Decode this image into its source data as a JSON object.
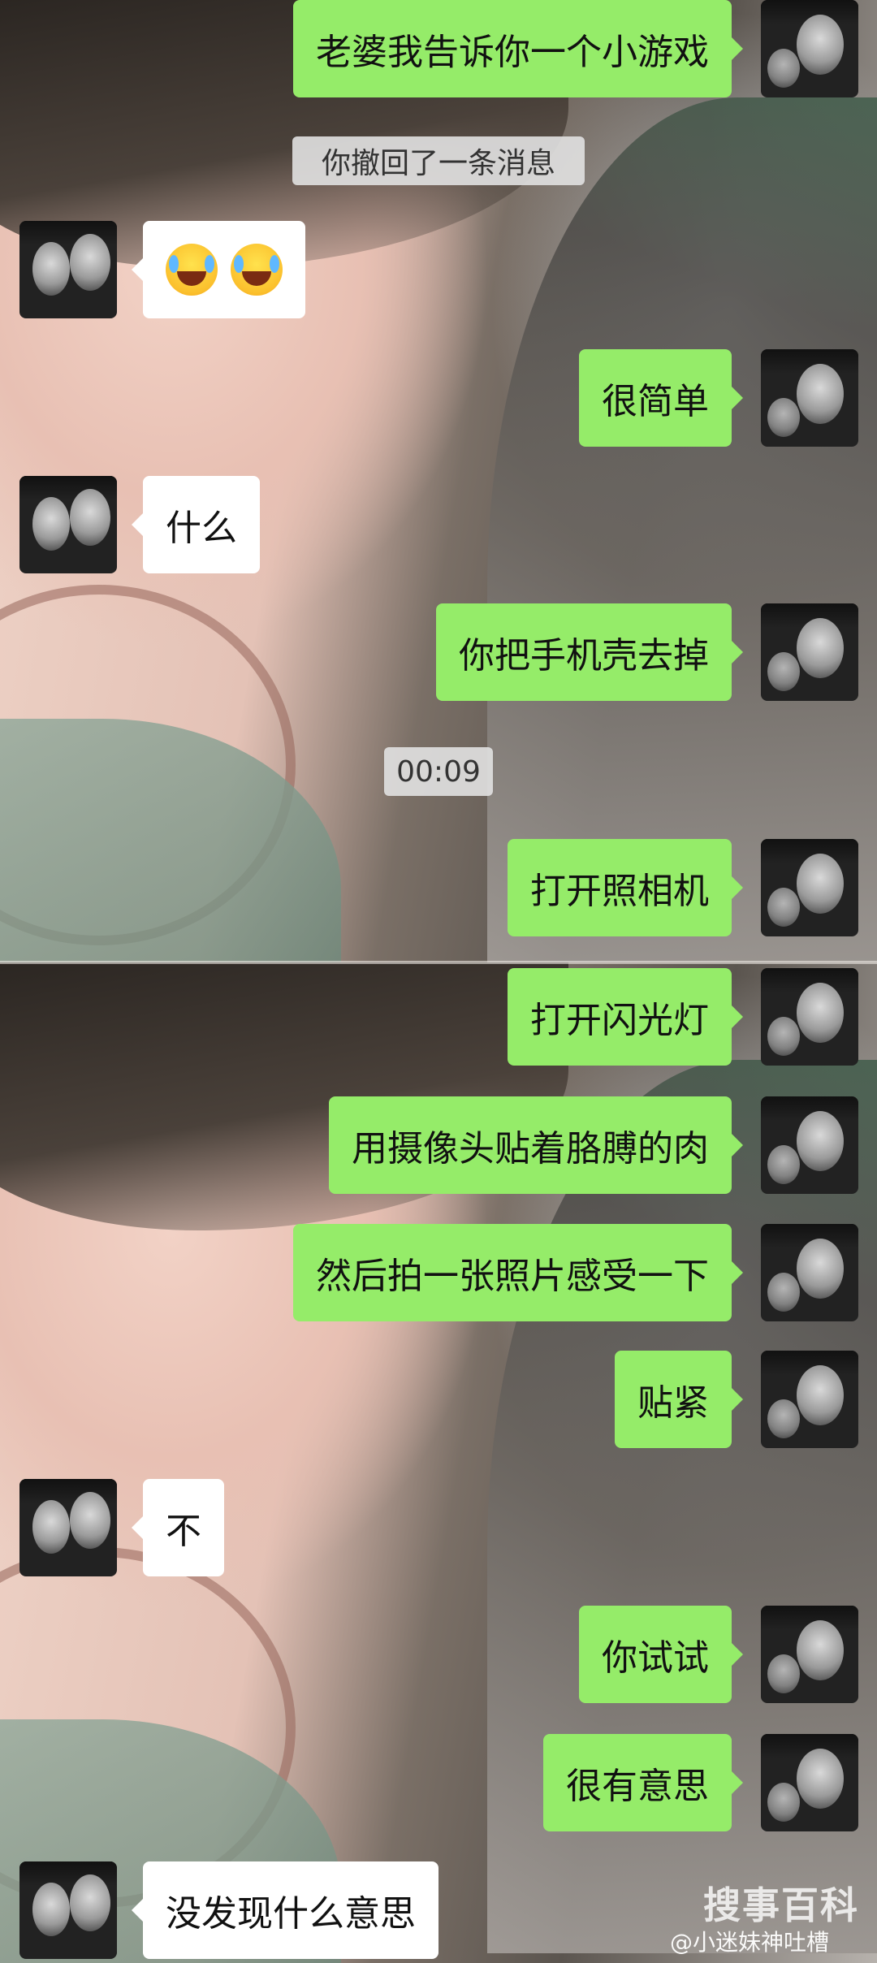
{
  "chat": {
    "recall_notice": "你撤回了一条消息",
    "voice_duration": "00:09",
    "messages": [
      {
        "side": "out",
        "text": "老婆我告诉你一个小游戏"
      },
      {
        "side": "in",
        "emoji": [
          "joy-tears-emoji",
          "joy-tears-emoji"
        ]
      },
      {
        "side": "out",
        "text": "很简单"
      },
      {
        "side": "in",
        "text": "什么"
      },
      {
        "side": "out",
        "text": "你把手机壳去掉"
      },
      {
        "side": "out",
        "text": "打开照相机"
      },
      {
        "side": "out",
        "text": "打开闪光灯"
      },
      {
        "side": "out",
        "text": "用摄像头贴着胳膊的肉"
      },
      {
        "side": "out",
        "text": "然后拍一张照片感受一下"
      },
      {
        "side": "out",
        "text": "贴紧"
      },
      {
        "side": "in",
        "text": "不"
      },
      {
        "side": "out",
        "text": "你试试"
      },
      {
        "side": "out",
        "text": "很有意思"
      },
      {
        "side": "in",
        "text": "没发现什么意思"
      }
    ]
  },
  "colors": {
    "outgoing_bubble": "#95ec69",
    "incoming_bubble": "#ffffff"
  },
  "watermark": {
    "logo_text": "搜事百科",
    "credit": "@小迷妹神吐槽"
  }
}
